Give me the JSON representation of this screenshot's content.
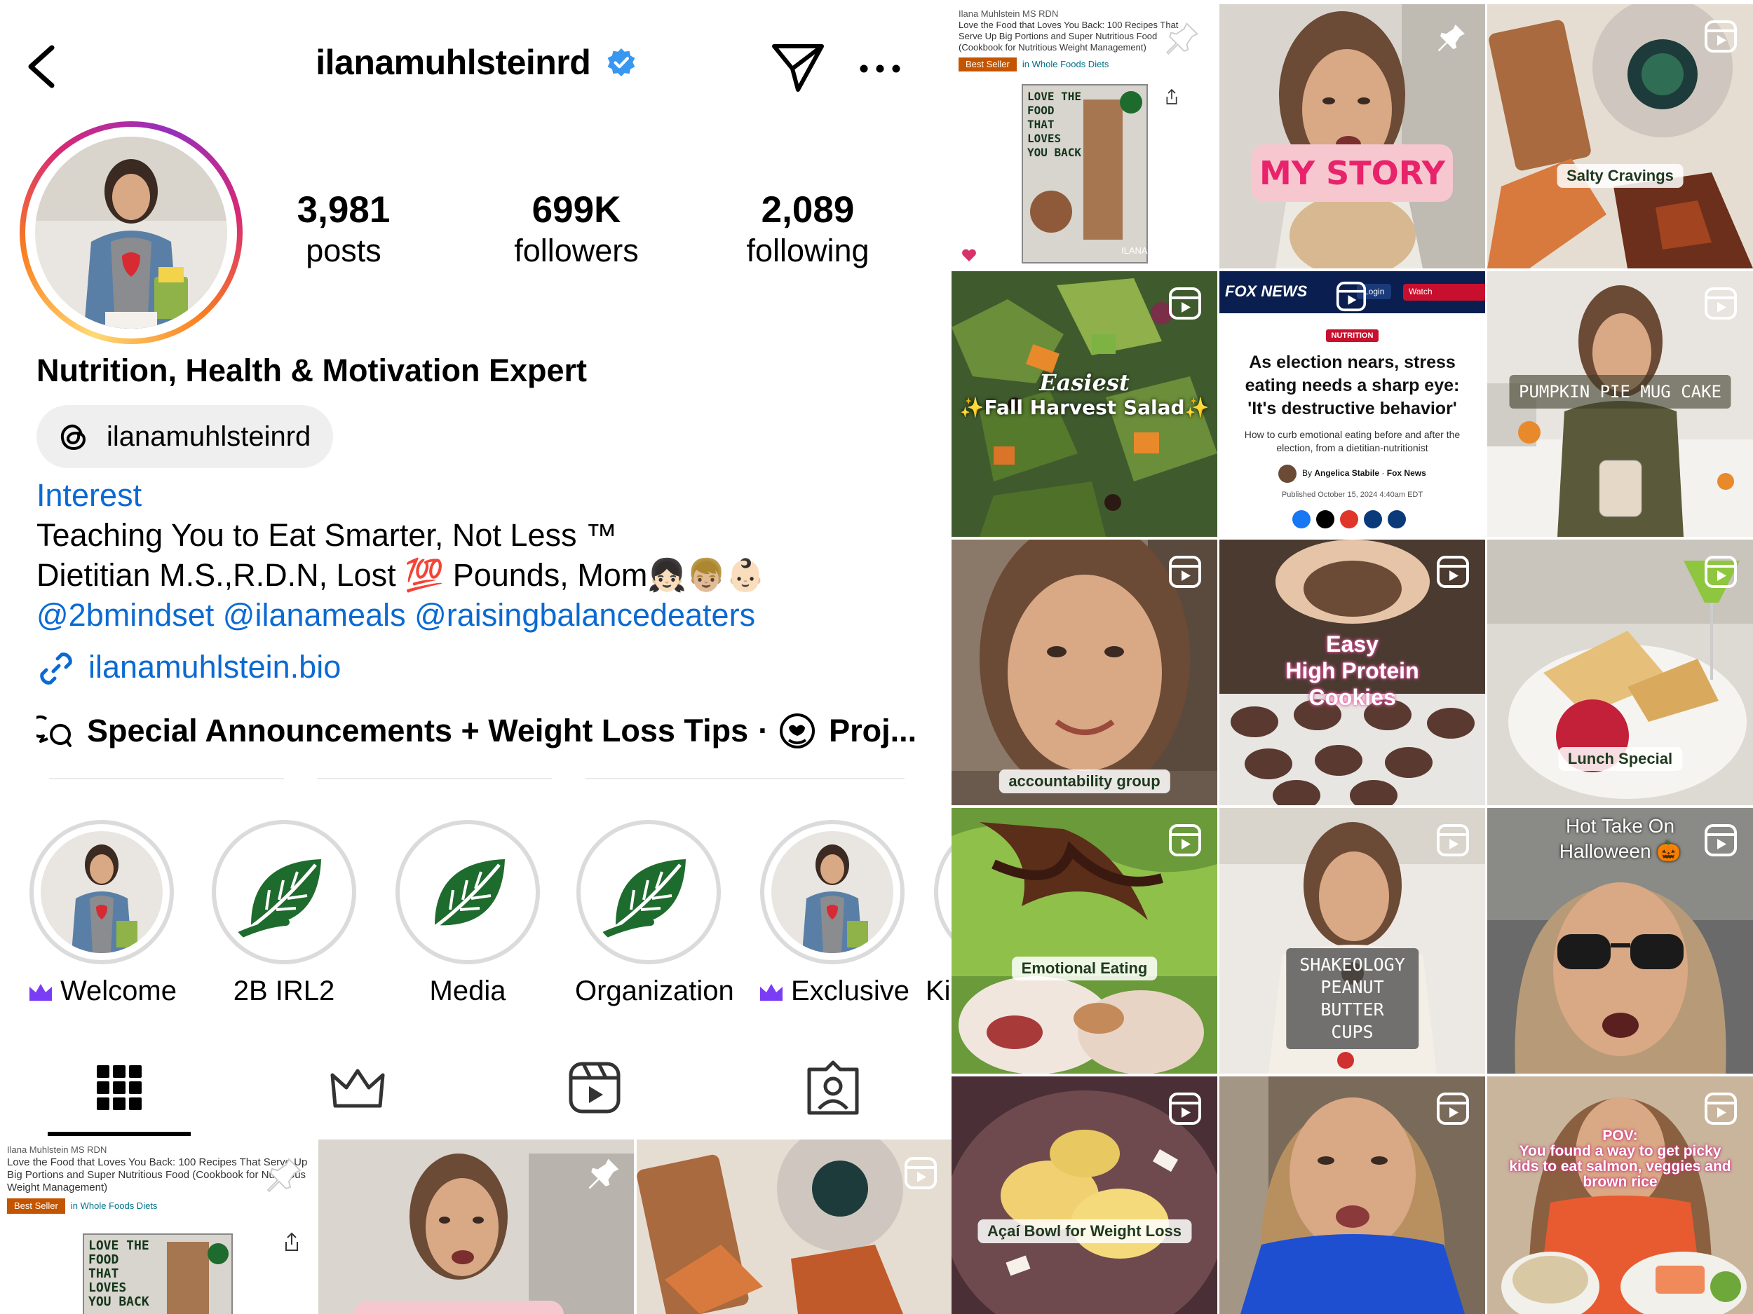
{
  "header": {
    "username": "ilanamuhlsteinrd"
  },
  "stats": {
    "posts_count": "3,981",
    "posts_label": "posts",
    "followers_count": "699K",
    "followers_label": "followers",
    "following_count": "2,089",
    "following_label": "following"
  },
  "bio": {
    "title": "Nutrition, Health & Motivation Expert",
    "threads_handle": "ilanamuhlsteinrd",
    "category": "Interest",
    "line1": "Teaching You to Eat Smarter, Not Less ™",
    "line2_a": "Dietitian M.S.,R.D.N, Lost ",
    "line2_emoji": "💯",
    "line2_b": " Pounds, Mom",
    "line2_family": "👧🏻👦🏼👶🏻",
    "mentions": "@2bmindset @ilanameals @raisingbalancedeaters",
    "link": "ilanamuhlstein.bio"
  },
  "channels": {
    "first": "Special Announcements + Weight Loss Tips",
    "separator": "·",
    "second": "Proj..."
  },
  "highlights": [
    {
      "label": "Welcome"
    },
    {
      "label": "2B IRL2"
    },
    {
      "label": "Media"
    },
    {
      "label": "Organization"
    },
    {
      "label": "Exclusive"
    },
    {
      "label": "Ki"
    }
  ],
  "tiles": {
    "book_author": "Ilana Muhlstein MS RDN",
    "book_title": "Love the Food that Loves You Back: 100 Recipes That Serve Up Big Portions and Super Nutritious Food (Cookbook for Nutritious Weight Management)",
    "book_badge": "Best Seller",
    "book_category": "in Whole Foods Diets",
    "book_cover": "LOVE THE FOOD THAT LOVES YOU BACK",
    "book_cover_brand": "ILANA",
    "my_story": "MY STORY",
    "salty_cravings": "Salty Cravings",
    "salad_l1": "Easiest",
    "salad_l2": "✨Fall Harvest Salad✨",
    "fox_logo": "FOX NEWS",
    "fox_login": "Login",
    "fox_watch": "Watch",
    "fox_tag": "NUTRITION",
    "fox_headline": "As election nears, stress eating needs a sharp eye: 'It's destructive behavior'",
    "fox_sub": "How to curb emotional eating before and after the election, from a dietitian-nutritionist",
    "fox_by": "By",
    "fox_author": "Angelica Stabile",
    "fox_outlet": "Fox News",
    "fox_published": "Published October 15, 2024 4:40am EDT",
    "pumpkin": "PUMPKIN PIE MUG CAKE",
    "accountability": "accountability group",
    "cookies": "Easy\nHigh Protein\nCookies",
    "lunch": "Lunch Special",
    "emotional": "Emotional Eating",
    "shakeology": "SHAKEOLOGY\nPEANUT BUTTER CUPS",
    "halloween": "Hot Take On\nHalloween 🎃",
    "acai": "Açaí Bowl for Weight Loss",
    "pov_l1": "POV:",
    "pov_l2": "You found a way to get picky kids to eat salmon, veggies and brown rice"
  },
  "colors": {
    "link_blue": "#0b6ad2",
    "verified_blue": "#3897f0",
    "crown_purple": "#7b3cf5",
    "leaf_green": "#1e6b2e",
    "fox_blue": "#0a1f4f",
    "fox_red": "#c8102e"
  },
  "icons": {
    "back": "chevron-left-icon",
    "verified": "verified-badge-icon",
    "send": "paper-plane-icon",
    "more": "more-dots-icon",
    "threads": "threads-logo-icon",
    "link": "link-icon",
    "channel": "chat-bubbles-icon",
    "channel2": "heart-face-icon",
    "tab_grid": "grid-icon",
    "tab_subscribed": "crown-icon",
    "tab_reels": "reels-icon",
    "tab_tagged": "tagged-person-icon",
    "pin": "pin-icon",
    "reel": "reel-icon"
  }
}
